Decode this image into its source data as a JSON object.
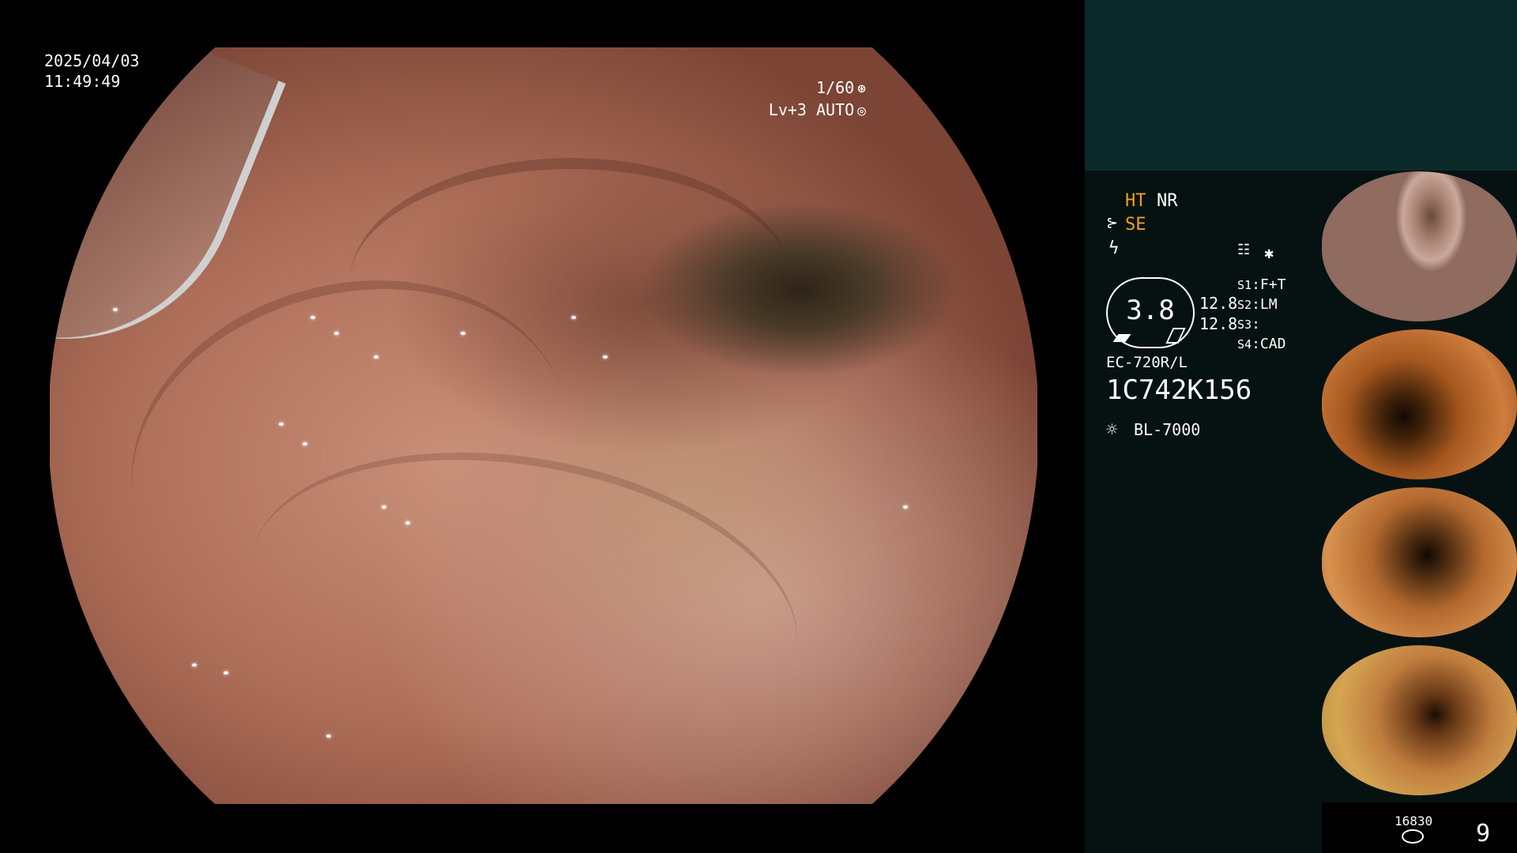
{
  "overlay": {
    "date": "2025/04/03",
    "time": "11:49:49",
    "shutter": "1/60",
    "light_level": "Lv+3 AUTO"
  },
  "panel": {
    "ht": "HT",
    "nr": "NR",
    "se": "SE",
    "score": "3.8",
    "stat_1": "12.8",
    "stat_2": "12.8",
    "slots": [
      {
        "key": "S1",
        "value": "F+T"
      },
      {
        "key": "S2",
        "value": "LM"
      },
      {
        "key": "S3",
        "value": ""
      },
      {
        "key": "S4",
        "value": "CAD"
      }
    ],
    "scope_model": "EC-720R/L",
    "serial": "1C742K156",
    "light_source": "BL-7000",
    "storage_count": "16830",
    "image_count": "9"
  },
  "thumbnails": {
    "caption": "1C742K156"
  },
  "colors": {
    "accent_orange": "#f0a020",
    "panel_bg": "#061212",
    "top_panel_bg": "#0d2a2a"
  }
}
